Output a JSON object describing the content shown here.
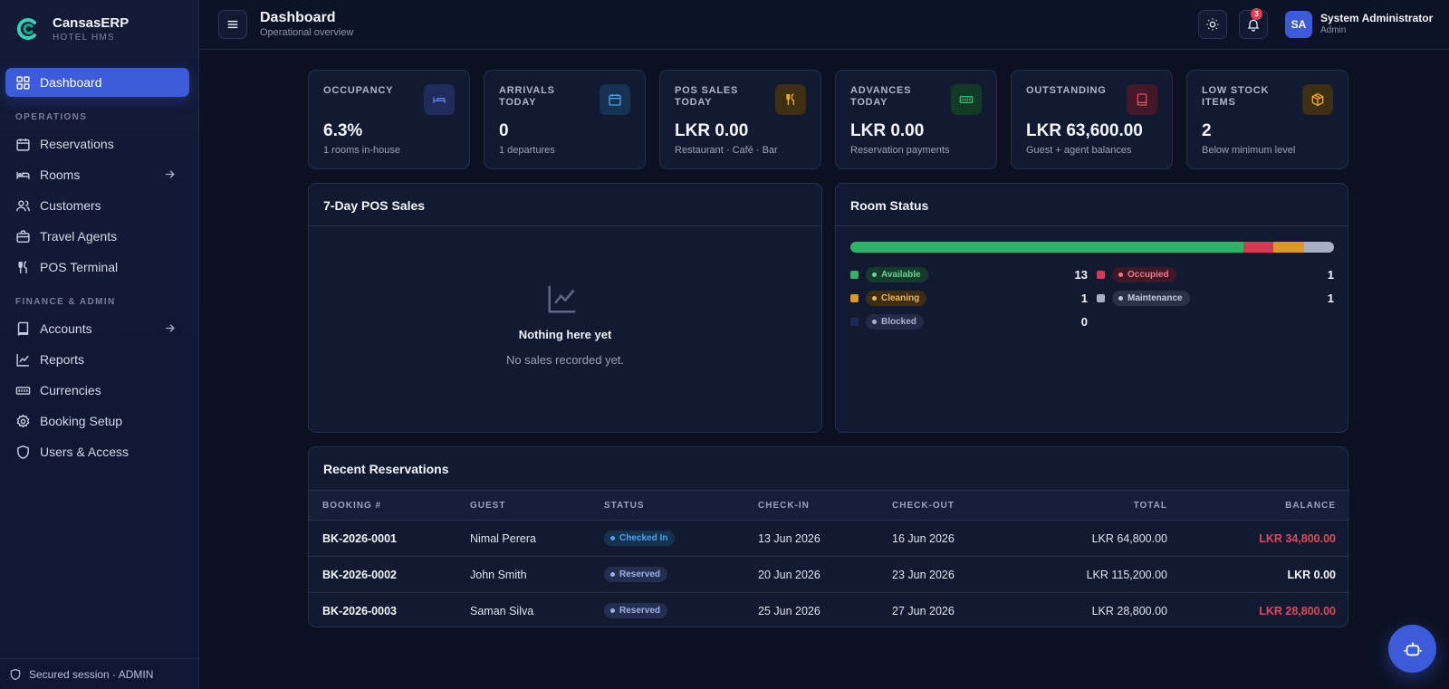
{
  "brand": {
    "name": "CansasERP",
    "sub": "HOTEL HMS"
  },
  "sidebar": {
    "items": [
      {
        "label": "Dashboard",
        "icon": "grid-icon",
        "active": true
      },
      {
        "label": "Reservations",
        "icon": "calendar-icon"
      },
      {
        "label": "Rooms",
        "icon": "bed-icon",
        "arrow": true
      },
      {
        "label": "Customers",
        "icon": "users-icon"
      },
      {
        "label": "Travel Agents",
        "icon": "briefcase-icon"
      },
      {
        "label": "POS Terminal",
        "icon": "utensils-icon"
      },
      {
        "label": "Accounts",
        "icon": "book-icon",
        "arrow": true
      },
      {
        "label": "Reports",
        "icon": "chart-line-icon"
      },
      {
        "label": "Currencies",
        "icon": "banknote-icon"
      },
      {
        "label": "Booking Setup",
        "icon": "gear-icon"
      },
      {
        "label": "Users & Access",
        "icon": "shield-icon"
      }
    ],
    "sections": {
      "operations": "OPERATIONS",
      "finance": "FINANCE & ADMIN"
    },
    "footer": "Secured session · ADMIN"
  },
  "header": {
    "title": "Dashboard",
    "subtitle": "Operational overview",
    "notifications": "3",
    "user": {
      "initials": "SA",
      "name": "System Administrator",
      "role": "Admin"
    }
  },
  "cards": [
    {
      "label": "OCCUPANCY",
      "value": "6.3%",
      "sub": "1 rooms in-house",
      "icon": "bed-icon",
      "color": "#5b7cf7",
      "bg": "#1f2d5c"
    },
    {
      "label": "ARRIVALS TODAY",
      "value": "0",
      "sub": "1 departures",
      "icon": "calendar-icon",
      "color": "#4aa3e6",
      "bg": "#163354"
    },
    {
      "label": "POS SALES TODAY",
      "value": "LKR 0.00",
      "sub": "Restaurant · Café · Bar",
      "icon": "utensils-icon",
      "color": "#f0a92b",
      "bg": "#3d2f12"
    },
    {
      "label": "ADVANCES TODAY",
      "value": "LKR 0.00",
      "sub": "Reservation payments",
      "icon": "banknote-icon",
      "color": "#2fbf71",
      "bg": "#123a27"
    },
    {
      "label": "OUTSTANDING",
      "value": "LKR 63,600.00",
      "sub": "Guest + agent balances",
      "icon": "book-icon",
      "color": "#e6485d",
      "bg": "#43192a"
    },
    {
      "label": "LOW STOCK ITEMS",
      "value": "2",
      "sub": "Below minimum level",
      "icon": "box-icon",
      "color": "#f0a92b",
      "bg": "#3d2f12"
    }
  ],
  "pos_panel": {
    "title": "7-Day POS Sales",
    "empty_title": "Nothing here yet",
    "empty_sub": "No sales recorded yet."
  },
  "room_status": {
    "title": "Room Status",
    "statuses": [
      {
        "label": "Available",
        "count": "13",
        "color": "#2fb36a",
        "pill_bg": "#15392a",
        "text": "#5fd596"
      },
      {
        "label": "Occupied",
        "count": "1",
        "color": "#d8394f",
        "pill_bg": "#3d1826",
        "text": "#f0788a"
      },
      {
        "label": "Cleaning",
        "count": "1",
        "color": "#d99a1e",
        "pill_bg": "#3b2e12",
        "text": "#f0b64a"
      },
      {
        "label": "Maintenance",
        "count": "1",
        "color": "#a8b0c7",
        "pill_bg": "#293249",
        "text": "#c2c9dc"
      },
      {
        "label": "Blocked",
        "count": "0",
        "color": "#1c2a55",
        "pill_bg": "#212b45",
        "text": "#aab2c8"
      }
    ],
    "bar": [
      {
        "fraction": 0.8125,
        "color": "#2fb36a"
      },
      {
        "fraction": 0.0625,
        "color": "#d8394f"
      },
      {
        "fraction": 0.0625,
        "color": "#d99a1e"
      },
      {
        "fraction": 0.0625,
        "color": "#a8b0c7"
      }
    ]
  },
  "reservations": {
    "title": "Recent Reservations",
    "columns": [
      "BOOKING #",
      "GUEST",
      "STATUS",
      "CHECK-IN",
      "CHECK-OUT",
      "TOTAL",
      "BALANCE"
    ],
    "rows": [
      {
        "booking": "BK-2026-0001",
        "guest": "Nimal Perera",
        "status": "Checked In",
        "status_color": "#4aa3e6",
        "status_bg": "#16324f",
        "checkin": "13 Jun 2026",
        "checkout": "16 Jun 2026",
        "total": "LKR 64,800.00",
        "balance": "LKR 34,800.00",
        "balance_due": true
      },
      {
        "booking": "BK-2026-0002",
        "guest": "John Smith",
        "status": "Reserved",
        "status_color": "#9fb0e6",
        "status_bg": "#232e50",
        "checkin": "20 Jun 2026",
        "checkout": "23 Jun 2026",
        "total": "LKR 115,200.00",
        "balance": "LKR 0.00",
        "balance_due": false
      },
      {
        "booking": "BK-2026-0003",
        "guest": "Saman Silva",
        "status": "Reserved",
        "status_color": "#9fb0e6",
        "status_bg": "#232e50",
        "checkin": "25 Jun 2026",
        "checkout": "27 Jun 2026",
        "total": "LKR 28,800.00",
        "balance": "LKR 28,800.00",
        "balance_due": true
      }
    ]
  }
}
